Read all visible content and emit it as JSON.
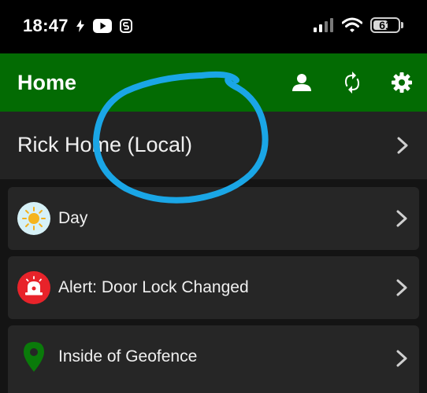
{
  "status_bar": {
    "time": "18:47",
    "battery_level": "61",
    "battery_fraction": 0.61
  },
  "header": {
    "title": "Home",
    "background_color": "#036b03",
    "icons": [
      "person-icon",
      "sync-icon",
      "gear-icon"
    ]
  },
  "hub": {
    "label": "Rick Home (Local)"
  },
  "cards": [
    {
      "label": "Day",
      "icon": "sun-icon"
    },
    {
      "label": "Alert: Door Lock Changed",
      "icon": "alarm-icon"
    },
    {
      "label": "Inside of Geofence",
      "icon": "location-pin-icon"
    }
  ],
  "annotation": {
    "color": "#1aa6e6",
    "shape": "hand-drawn-circle"
  }
}
